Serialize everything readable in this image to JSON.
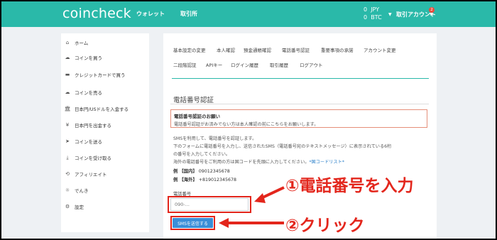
{
  "header": {
    "logo": "coincheck",
    "nav": [
      "ウォレット",
      "取引所"
    ],
    "balances": [
      {
        "amount": "0",
        "currency": "JPY"
      },
      {
        "amount": "0",
        "currency": "BTC"
      }
    ],
    "account_label": "取引アカウント",
    "badge_count": "2"
  },
  "sidebar": {
    "items": [
      {
        "label": "ホーム",
        "icon": "home-icon",
        "glyph": "⌂"
      },
      {
        "label": "コインを買う",
        "icon": "cloud-upload-icon",
        "glyph": "☁"
      },
      {
        "label": "クレジットカードで買う",
        "icon": "credit-card-icon",
        "glyph": "▬"
      },
      {
        "label": "コインを売る",
        "icon": "cloud-download-icon",
        "glyph": "☁"
      },
      {
        "label": "日本円/USドルを入金する",
        "icon": "bank-icon",
        "glyph": "🏛"
      },
      {
        "label": "日本円を出金する",
        "icon": "yen-icon",
        "glyph": "¥"
      },
      {
        "label": "コインを送る",
        "icon": "send-icon",
        "glyph": "➤"
      },
      {
        "label": "コインを受け取る",
        "icon": "download-icon",
        "glyph": "⤓"
      },
      {
        "label": "アフィリエイト",
        "icon": "affiliate-icon",
        "glyph": "⟲"
      },
      {
        "label": "でんき",
        "icon": "lightbulb-icon",
        "glyph": "☼"
      },
      {
        "label": "設定",
        "icon": "gear-icon",
        "glyph": "⚙"
      }
    ]
  },
  "tabs": {
    "row1": [
      "基本設定の変更",
      "本人確認",
      "預金通帳確認",
      "電話番号認証",
      "重要事項の承諾",
      "アカウント変更"
    ],
    "row2": [
      "二段階認証",
      "APIキー",
      "ログイン履歴",
      "取引履歴",
      "ログアウト"
    ]
  },
  "section": {
    "title": "電話番号認証",
    "notice_title": "電話番号認証のお願い",
    "notice_body": "電話番号認証がお済みでない方は本人確認の前にこちらをお願いします。",
    "desc1": "SMSを利用して、電話番号を認証します。",
    "desc2": "下のフォームに電話番号を入力し、送信されたSMS（電話番号宛のテキストメッセージ）に表示されている6桁",
    "desc3": "の番号を入力してください。",
    "desc4": "海外の電話番号をご利用の方は国コードを先頭に入力してください。",
    "desc4_link": "*国コードリスト*",
    "example1_label": "例 【国内】",
    "example1_value": "09012345678",
    "example2_label": "例 【海外】",
    "example2_value": "+819012345678",
    "field_label": "電話番号",
    "field_placeholder": "090-...",
    "submit_label": "SMSを送信する"
  },
  "annotations": {
    "step1": "①電話番号を入力",
    "step2": "②クリック"
  },
  "colors": {
    "header": "#2ab9a9",
    "annotation": "#e3261c",
    "button": "#3a8fd8"
  }
}
